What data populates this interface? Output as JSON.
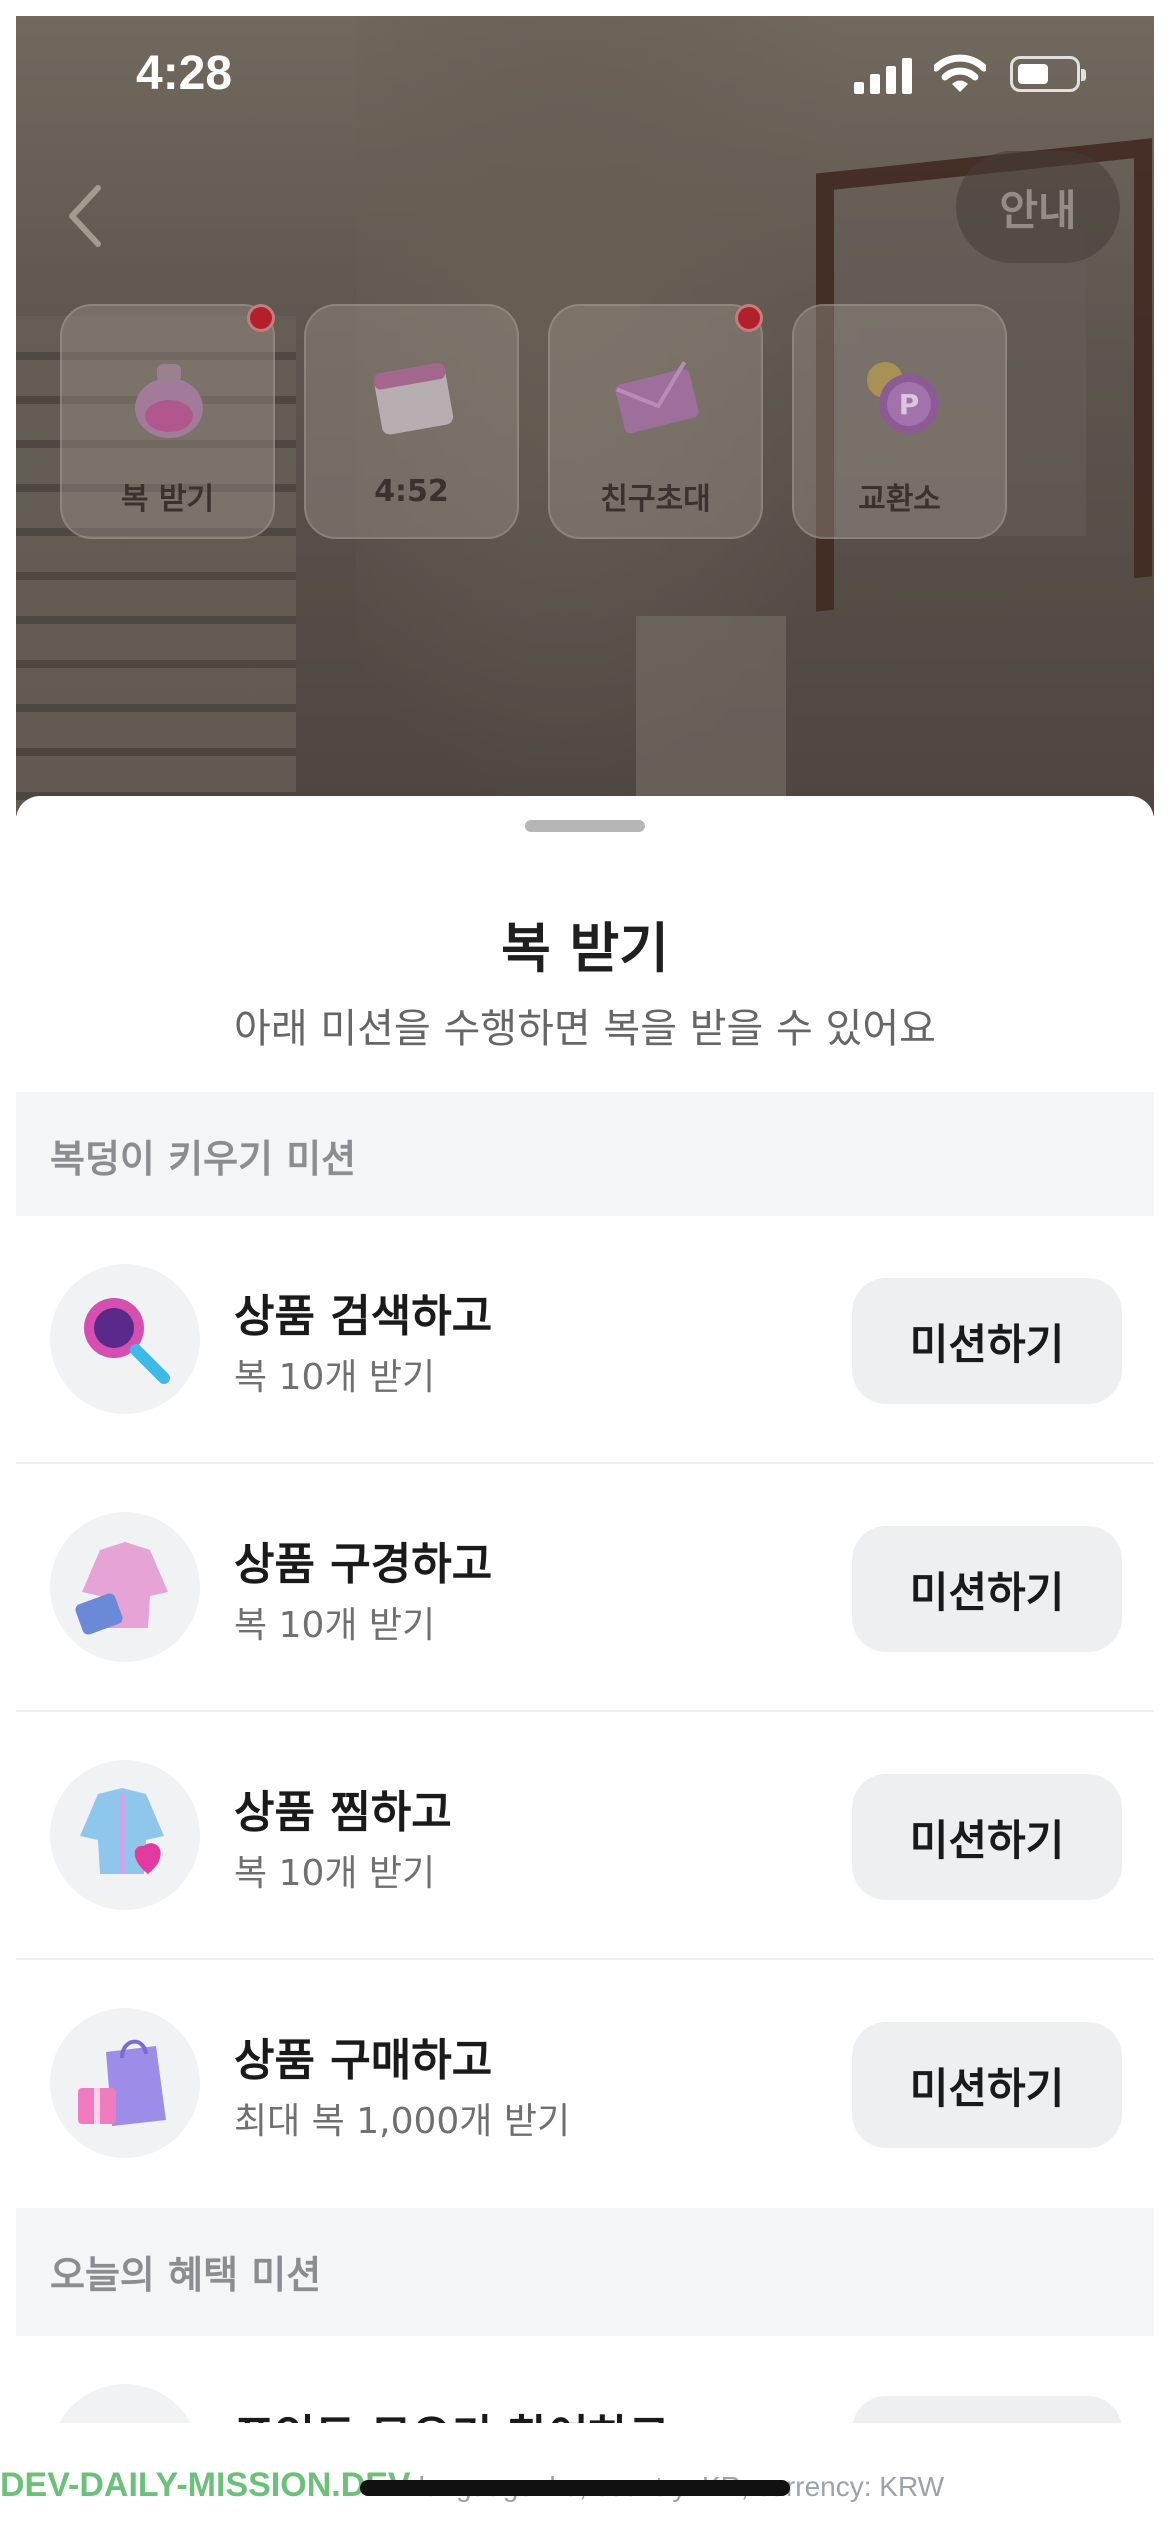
{
  "status_bar": {
    "time": "4:28"
  },
  "header": {
    "guide_label": "안내"
  },
  "tiles": [
    {
      "label": "복 받기",
      "icon": "pouch-icon",
      "has_badge": true
    },
    {
      "label": "4:52",
      "icon": "calendar-icon",
      "has_badge": false
    },
    {
      "label": "친구초대",
      "icon": "envelope-icon",
      "has_badge": true
    },
    {
      "label": "교환소",
      "icon": "point-coin-icon",
      "has_badge": false
    }
  ],
  "sheet": {
    "title": "복 받기",
    "subtitle": "아래 미션을 수행하면 복을 받을 수 있어요",
    "section1": "복덩이 키우기 미션",
    "section2": "오늘의 혜택 미션",
    "missions": [
      {
        "title": "상품 검색하고",
        "desc": "복 10개 받기",
        "button": "미션하기",
        "icon": "magnifier-icon"
      },
      {
        "title": "상품 구경하고",
        "desc": "복 10개 받기",
        "button": "미션하기",
        "icon": "jacket-palette-icon"
      },
      {
        "title": "상품 찜하고",
        "desc": "복 10개 받기",
        "button": "미션하기",
        "icon": "jacket-heart-icon"
      },
      {
        "title": "상품 구매하고",
        "desc": "최대 복 1,000개 받기",
        "button": "미션하기",
        "icon": "shopping-bag-icon"
      }
    ],
    "partial_mission": {
      "title": "포인트 모으기 참여하고"
    }
  },
  "debug": {
    "env": "DEV-DAILY-MISSION.DEV",
    "meta": "language: ko, country: KR, currency: KRW"
  },
  "colors": {
    "badge": "#b3202a",
    "button_bg": "#eeeff1",
    "section_bg": "#f4f5f6",
    "debug_green": "#6cc07a"
  }
}
